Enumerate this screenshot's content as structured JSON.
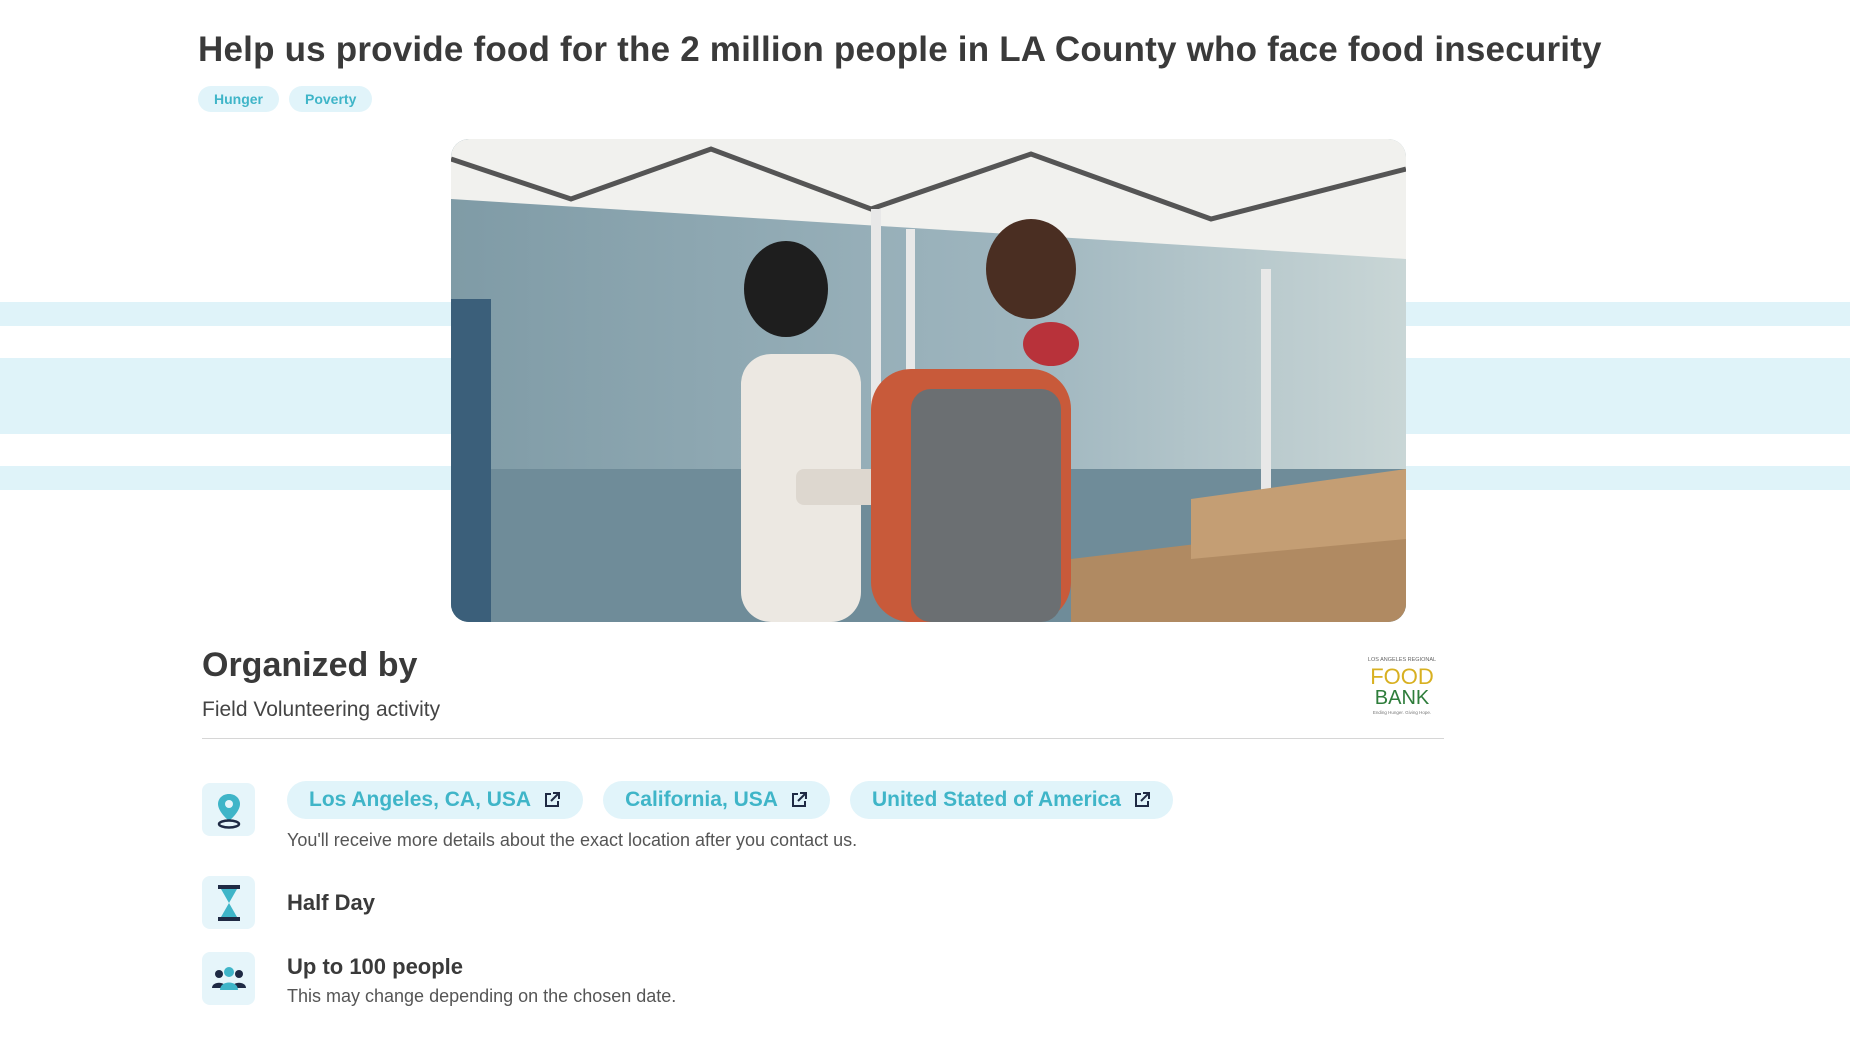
{
  "title": "Help us provide food for the 2 million people in LA County who face food insecurity",
  "tags": [
    "Hunger",
    "Poverty"
  ],
  "organizer": {
    "heading": "Organized by",
    "activity_type": "Field Volunteering activity",
    "logo": {
      "small_text": "LOS ANGELES REGIONAL",
      "word1": "FOOD",
      "word2": "BANK",
      "tagline": "Ending Hunger. Giving Hope."
    }
  },
  "locations": [
    {
      "label": "Los Angeles, CA, USA",
      "icon": "external-link-icon"
    },
    {
      "label": "California, USA",
      "icon": "external-link-icon"
    },
    {
      "label": "United Stated of America",
      "icon": "external-link-icon"
    }
  ],
  "location_note": "You'll receive more details about the exact location after you contact us.",
  "duration": {
    "icon": "hourglass-icon",
    "label": "Half Day"
  },
  "capacity": {
    "icon": "people-icon",
    "label": "Up to 100 people",
    "note": "This may change depending on the chosen date."
  },
  "colors": {
    "accent": "#3fb5c8",
    "chip_bg": "#e1f4fa",
    "stripe": "#dff3f9"
  }
}
